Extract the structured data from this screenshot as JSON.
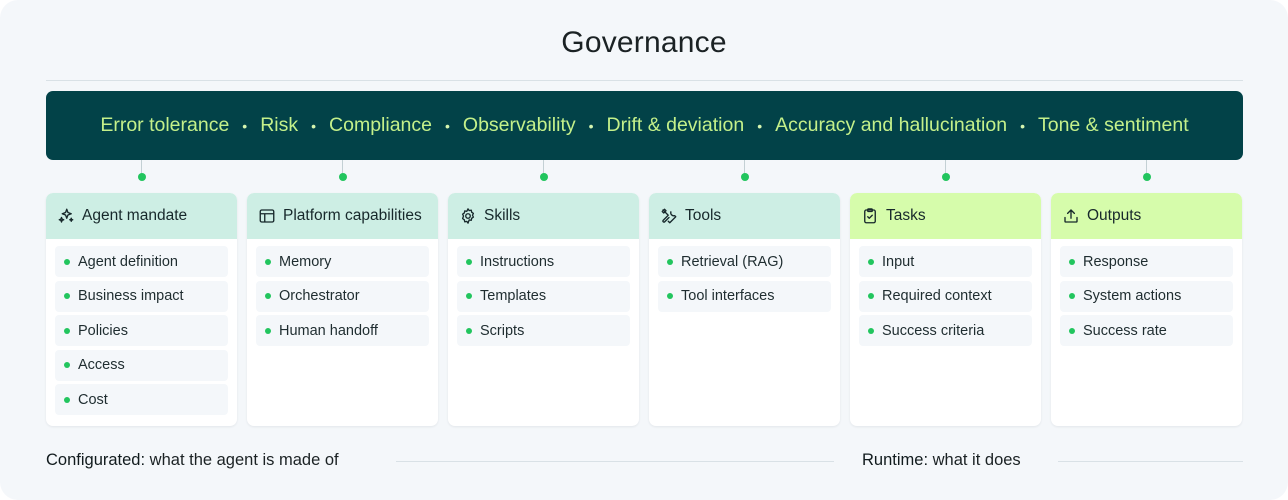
{
  "title": "Governance",
  "governance": {
    "items": [
      "Error tolerance",
      "Risk",
      "Compliance",
      "Observability",
      "Drift & deviation",
      "Accuracy and hallucination",
      "Tone & sentiment"
    ],
    "separator": "•"
  },
  "cards": [
    {
      "title": "Agent mandate",
      "icon": "sparkles-icon",
      "group": "config",
      "items": [
        "Agent definition",
        "Business impact",
        "Policies",
        "Access",
        "Cost"
      ]
    },
    {
      "title": "Platform capabilities",
      "icon": "layout-icon",
      "group": "config",
      "items": [
        "Memory",
        "Orchestrator",
        "Human handoff"
      ]
    },
    {
      "title": "Skills",
      "icon": "gear-icon",
      "group": "config",
      "items": [
        "Instructions",
        "Templates",
        "Scripts"
      ]
    },
    {
      "title": "Tools",
      "icon": "wrench-screwdriver-icon",
      "group": "config",
      "items": [
        "Retrieval (RAG)",
        "Tool interfaces"
      ]
    },
    {
      "title": "Tasks",
      "icon": "clipboard-check-icon",
      "group": "runtime",
      "items": [
        "Input",
        "Required context",
        "Success criteria"
      ]
    },
    {
      "title": "Outputs",
      "icon": "upload-icon",
      "group": "runtime",
      "items": [
        "Response",
        "System actions",
        "Success rate"
      ]
    }
  ],
  "footer": {
    "configurated_label": "Configurated:",
    "configurated_text": "what the agent is made of",
    "runtime_label": "Runtime:",
    "runtime_text": "what it does"
  },
  "colors": {
    "governance_bg": "#024248",
    "governance_text": "#c4f08a",
    "config_header": "#cdeee4",
    "runtime_header": "#d6fcab",
    "bullet": "#22c55e"
  }
}
